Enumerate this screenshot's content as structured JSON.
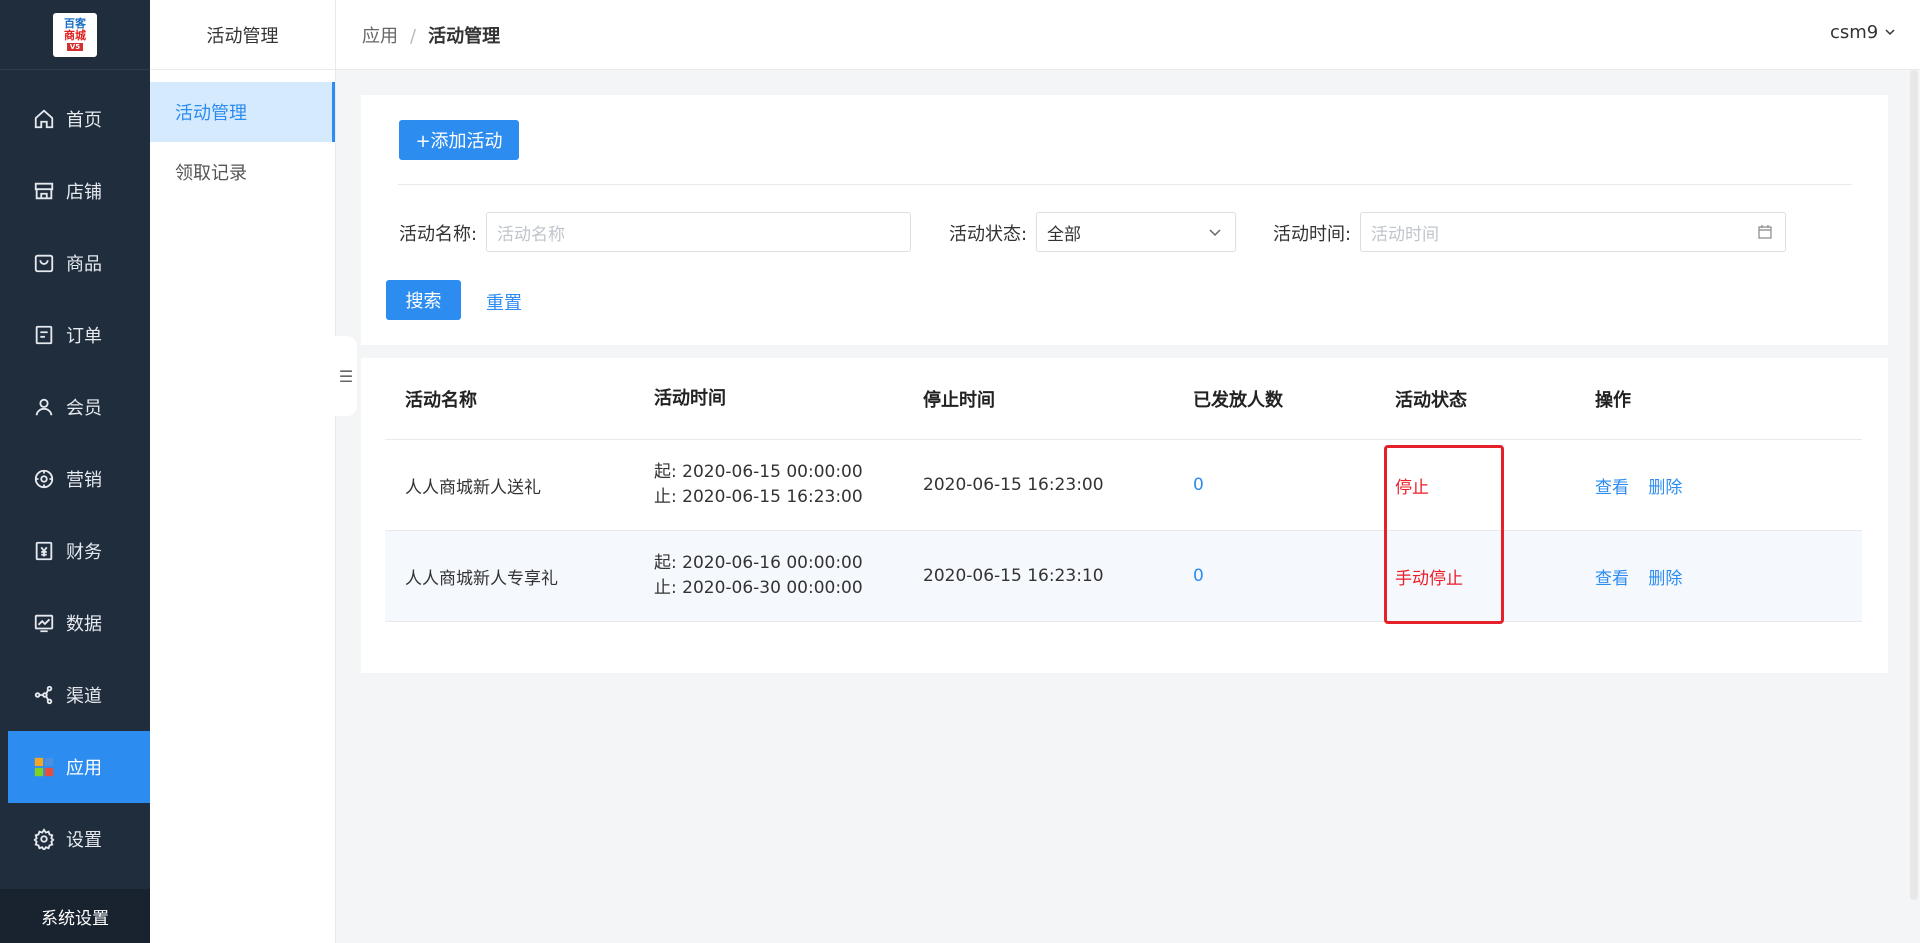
{
  "logo": {
    "line1": "百客",
    "line2": "商城",
    "tag": "V5"
  },
  "nav": {
    "items": [
      {
        "label": "首页",
        "icon": "home-icon"
      },
      {
        "label": "店铺",
        "icon": "store-icon"
      },
      {
        "label": "商品",
        "icon": "bag-icon"
      },
      {
        "label": "订单",
        "icon": "order-icon"
      },
      {
        "label": "会员",
        "icon": "user-icon"
      },
      {
        "label": "营销",
        "icon": "marketing-icon"
      },
      {
        "label": "财务",
        "icon": "finance-icon"
      },
      {
        "label": "数据",
        "icon": "chart-icon"
      },
      {
        "label": "渠道",
        "icon": "channel-icon"
      },
      {
        "label": "应用",
        "icon": "apps-icon",
        "active": true
      },
      {
        "label": "设置",
        "icon": "gear-icon"
      }
    ],
    "bottom_label": "系统设置"
  },
  "subnav": {
    "title": "活动管理",
    "items": [
      {
        "label": "活动管理",
        "active": true
      },
      {
        "label": "领取记录"
      }
    ]
  },
  "header": {
    "breadcrumb": [
      "应用",
      "活动管理"
    ],
    "separator": "/",
    "user": "csm9"
  },
  "filter": {
    "add_button": "+添加活动",
    "name_label": "活动名称:",
    "name_placeholder": "活动名称",
    "status_label": "活动状态:",
    "status_value": "全部",
    "time_label": "活动时间:",
    "time_placeholder": "活动时间",
    "search_button": "搜索",
    "reset_link": "重置"
  },
  "table": {
    "headers": [
      "活动名称",
      "活动时间",
      "停止时间",
      "已发放人数",
      "活动状态",
      "操作"
    ],
    "rows": [
      {
        "name": "人人商城新人送礼",
        "start": "起:  2020-06-15 00:00:00",
        "end": "止:  2020-06-15 16:23:00",
        "stop_time": "2020-06-15 16:23:00",
        "issued": "0",
        "status": "停止",
        "actions": [
          "查看",
          "删除"
        ]
      },
      {
        "name": "人人商城新人专享礼",
        "start": "起:  2020-06-16 00:00:00",
        "end": "止:  2020-06-30 00:00:00",
        "stop_time": "2020-06-15 16:23:10",
        "issued": "0",
        "status": "手动停止",
        "actions": [
          "查看",
          "删除"
        ]
      }
    ]
  },
  "colors": {
    "sidebar_bg": "#1f2d3d",
    "primary": "#2d8cf0",
    "status_red": "#ed1c24"
  }
}
